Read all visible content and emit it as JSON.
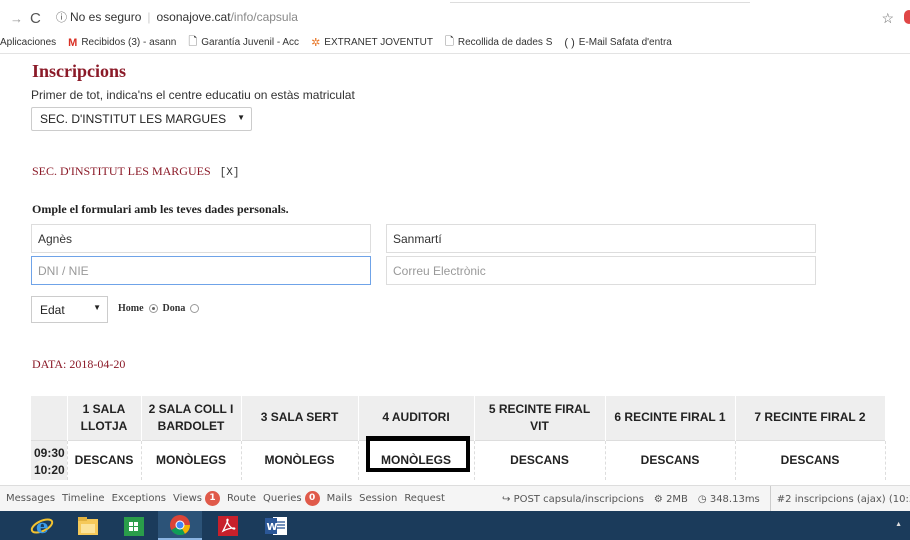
{
  "browser": {
    "security": "No es seguro",
    "url_host": "osonajove.cat",
    "url_path": "/info/capsula",
    "bookmarks": [
      {
        "icon": "apps",
        "label": "Aplicaciones"
      },
      {
        "icon": "gmail",
        "label": "Recibidos (3) - asann"
      },
      {
        "icon": "page",
        "label": "Garantía Juvenil - Acc"
      },
      {
        "icon": "extranet",
        "label": "EXTRANET JOVENTUT"
      },
      {
        "icon": "page",
        "label": "Recollida de dades S"
      },
      {
        "icon": "brackets",
        "label": "E-Mail Safata d'entra"
      }
    ]
  },
  "page": {
    "title": "Inscripcions",
    "intro": "Primer de tot, indica'ns el centre educatiu on estàs matriculat",
    "school_select": "SEC. D'INSTITUT LES MARGUES",
    "school_heading": "SEC. D'INSTITUT LES MARGUES",
    "school_remove": "[X]",
    "form_heading": "Omple el formulari amb les teves dades personals.",
    "fields": {
      "first_name": "Agnès",
      "last_name": "Sanmartí",
      "dni_placeholder": "DNI / NIE",
      "email_placeholder": "Correu Electrònic"
    },
    "age_select": "Edat",
    "gender": {
      "male": "Home",
      "female": "Dona",
      "selected": "male"
    },
    "date_label": "DATA: 2018-04-20"
  },
  "schedule": {
    "rooms": [
      "1 SALA LLOTJA",
      "2 SALA COLL I BARDOLET",
      "3 SALA SERT",
      "4 AUDITORI",
      "5 RECINTE FIRAL VIT",
      "6 RECINTE FIRAL 1",
      "7 RECINTE FIRAL 2"
    ],
    "rows": [
      {
        "time_start": "09:30",
        "time_end": "10:20",
        "cells": [
          "DESCANS",
          "MONÒLEGS",
          "MONÒLEGS",
          "MONÒLEGS",
          "DESCANS",
          "DESCANS",
          "DESCANS"
        ]
      }
    ]
  },
  "debugbar": {
    "messages": "Messages",
    "timeline": "Timeline",
    "exceptions": "Exceptions",
    "views": "Views",
    "views_count": "1",
    "route": "Route",
    "queries": "Queries",
    "queries_count": "0",
    "mails": "Mails",
    "session": "Session",
    "request": "Request",
    "post": "POST capsula/inscripcions",
    "memory": "2MB",
    "time": "348.13ms",
    "request_id": "#2 inscripcions (ajax) (10:3"
  },
  "colors": {
    "accent": "#8b1a28",
    "taskbar": "#1b3b5b",
    "badge": "#e05a4a"
  }
}
